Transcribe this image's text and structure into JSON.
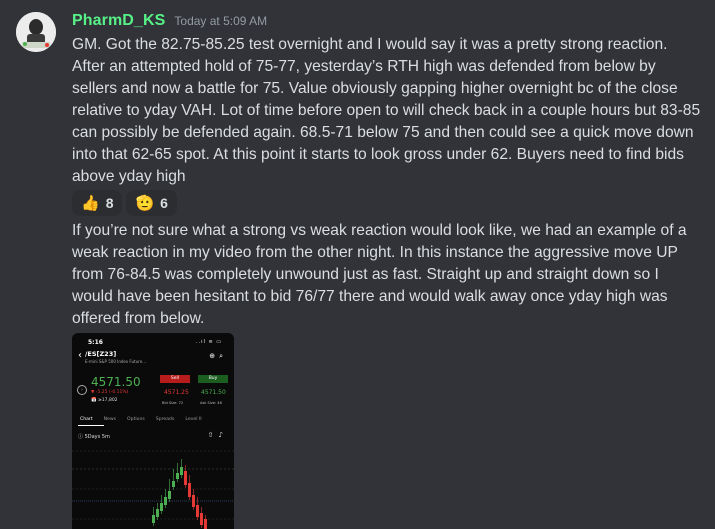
{
  "message": {
    "username": "PharmD_KS",
    "timestamp": "Today at 5:09 AM",
    "paragraph1": "GM. Got the 82.75-85.25 test overnight and I would say it was a pretty strong reaction. After an attempted hold of 75-77, yesterday’s RTH high was defended from below by sellers and now a battle for 75. Value obviously gapping higher overnight bc of the close relative to yday VAH. Lot of time before open to will check back in a couple hours but 83-85 can possibly be defended again. 68.5-71 below 75 and then could see a quick move down into that 62-65 spot. At this point it starts to look gross under 62. Buyers need to find bids above yday high",
    "paragraph2": "If you’re not sure what a strong vs weak reaction would look like, we had an example of a weak reaction in my video from the other night. In this instance the aggressive move UP from 76-84.5 was completely unwound just as fast. Straight up and straight down so I would have been hesitant to bid 76/77 there and would walk away once yday high was offered from below."
  },
  "reactions": [
    {
      "icon": "thumbs-up-icon",
      "emoji": "👍",
      "count": "8"
    },
    {
      "icon": "saluting-face-icon",
      "emoji": "🫡",
      "count": "6"
    }
  ],
  "attachment": {
    "status_time": "5:16",
    "status_right": "..ıl ≋ ▭",
    "symbol": "/ES[Z23]",
    "description": "E-mini S&P 500 Index Future...",
    "price": "4571.50",
    "change": "▼ -5.25 (-0.11%)",
    "volume": "📅 ≥17,802",
    "sell_label": "Sell",
    "buy_label": "Buy",
    "bid": "4571.25",
    "ask": "4571.50",
    "bid_size": "Bid Size: 72",
    "ask_size": "Ask Size: 46",
    "tabs": [
      "Chart",
      "News",
      "Options",
      "Spreads",
      "Level II"
    ],
    "chart_toolbar": "ⓘ 5Days 5m",
    "colors": {
      "up": "#4caf50",
      "down": "#e53935"
    }
  },
  "colors": {
    "username": "#57f287",
    "background": "#313338",
    "text": "#dbdee1"
  }
}
